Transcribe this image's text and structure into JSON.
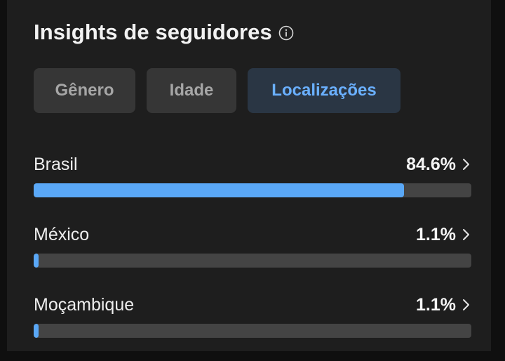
{
  "header": {
    "title": "Insights de seguidores",
    "info_icon": "info-circle-icon"
  },
  "tabs": [
    {
      "label": "Gênero",
      "active": false
    },
    {
      "label": "Idade",
      "active": false
    },
    {
      "label": "Localizações",
      "active": true
    }
  ],
  "locations": [
    {
      "country": "Brasil",
      "percent_label": "84.6%",
      "value": 84.6
    },
    {
      "country": "México",
      "percent_label": "1.1%",
      "value": 1.1
    },
    {
      "country": "Moçambique",
      "percent_label": "1.1%",
      "value": 1.1
    }
  ],
  "colors": {
    "card_background": "#1e1e1e",
    "bar_fill": "#5aa8f7",
    "bar_track": "#444444",
    "active_tab_text": "#6ab0ff",
    "active_tab_background": "#2a3644",
    "inactive_tab_background": "#363636"
  }
}
